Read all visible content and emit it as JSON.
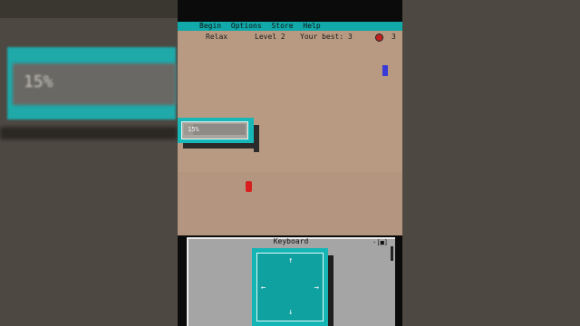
{
  "menu": {
    "items": [
      "Begin",
      "Options",
      "Store",
      "Help"
    ]
  },
  "status": {
    "mode": "Relax",
    "level": "Level 2",
    "best": "Your best: 3",
    "lives": "3"
  },
  "progress": {
    "label": "15%",
    "value": 0.15
  },
  "keyboard": {
    "title": "Keyboard",
    "close_label": "-[■]",
    "arrows": {
      "up": "↑",
      "down": "↓",
      "left": "←",
      "right": "→"
    }
  },
  "colors": {
    "accent": "#11a9a9",
    "field": "#b89a82",
    "blue_block": "#3a3ad6",
    "red_block": "#d81e1e"
  },
  "icons": {
    "lives": "heart-icon"
  }
}
